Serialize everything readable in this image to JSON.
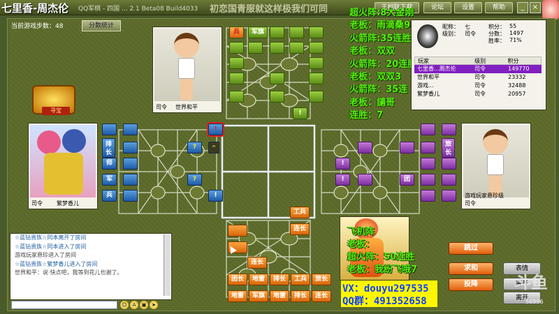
{
  "topbar": {
    "streamer": "七里香-周杰伦",
    "app_title": "QQ军棋 - 四国 ... 2.1 Beta08 Build4033",
    "marquee": "初恋国青服就这样极我们可同",
    "buttons": [
      "王相联下载",
      "论坛",
      "设置",
      "帮助"
    ]
  },
  "board_meta": {
    "steps_label": "当前游戏步数：48",
    "stats_button": "分数统计",
    "treasure_label": "寻宝"
  },
  "players": {
    "top": {
      "name": "世界和平",
      "rank": "司令"
    },
    "left": {
      "name": "繁梦香儿",
      "rank": "司令"
    },
    "right": {
      "name": "游戏玩家悬珍级",
      "rank": "司令"
    },
    "bottom": {
      "name": ""
    }
  },
  "pieces": {
    "green_flags": [
      "兵",
      "军旗"
    ],
    "blue_labels": [
      "排长",
      "师",
      "军",
      "兵"
    ],
    "purple_labels": [
      "旅长",
      "团"
    ],
    "orange": {
      "gongbing": "工兵",
      "lianzhang": "连长",
      "lianzhang2": "连长",
      "row1": [
        "团长",
        "地雷",
        "排长",
        "工兵",
        "旅长"
      ],
      "row2": [
        "地雷",
        "军旗",
        "地雷",
        "排长",
        "连长"
      ]
    },
    "markers": {
      "question": "?",
      "bang": "!",
      "up": "^"
    }
  },
  "stream_overlay": {
    "top_lines": [
      "超火阵:8大金刚",
      "老板：雨滴桑988",
      "火箭阵:35连胜",
      "老板：双双",
      "火箭阵：20连胜",
      "老板：双双3",
      "火箭阵：35连",
      "老板：讁哥",
      "连胜：7"
    ],
    "bottom_lines": [
      "飞机阵",
      "老板：",
      "超火阵：50连胜",
      "老板：我纷飞哦7"
    ],
    "contact_vx": "VX：douyu297535",
    "contact_qq": "QQ群：491352658"
  },
  "info_panel": {
    "nickname_label": "昵称：",
    "nickname_value": "七",
    "score_label": "积分：",
    "score_value": "55",
    "level_label": "级别：",
    "level_value": "司令",
    "total_label": "分数：",
    "total_value": "1497",
    "winrate_label": "胜率：",
    "winrate_value": "71%",
    "table_headers": [
      "玩家",
      "级别",
      "积分"
    ],
    "rows": [
      {
        "name": "七里香...周杰伦",
        "rank": "司令",
        "score": "149770"
      },
      {
        "name": "世界和平",
        "rank": "司令",
        "score": "23332"
      },
      {
        "name": "游戏...",
        "rank": "司令",
        "score": "32488"
      },
      {
        "name": "繁梦香儿",
        "rank": "司令",
        "score": "20957"
      }
    ]
  },
  "chat": {
    "lines": [
      "☆蓝钻贵族☆同本离开了房间",
      "☆蓝钻贵族☆同本进入了房间",
      "游戏玩家悬珍进入了房间",
      "☆蓝钻贵族☆繁梦香儿进入了房间",
      "世界和平：说·快点吧，我等到花儿也谢了。"
    ],
    "input_placeholder": "",
    "icons": [
      "smile-icon",
      "font-icon",
      "image-icon",
      "send-icon"
    ]
  },
  "actions": {
    "skip": "跳过",
    "peace": "求和",
    "surrender": "投降",
    "emote": "表情",
    "quit": "离开",
    "leave": "离开"
  },
  "watermark": {
    "text": "斗鱼",
    "number": "56996"
  }
}
